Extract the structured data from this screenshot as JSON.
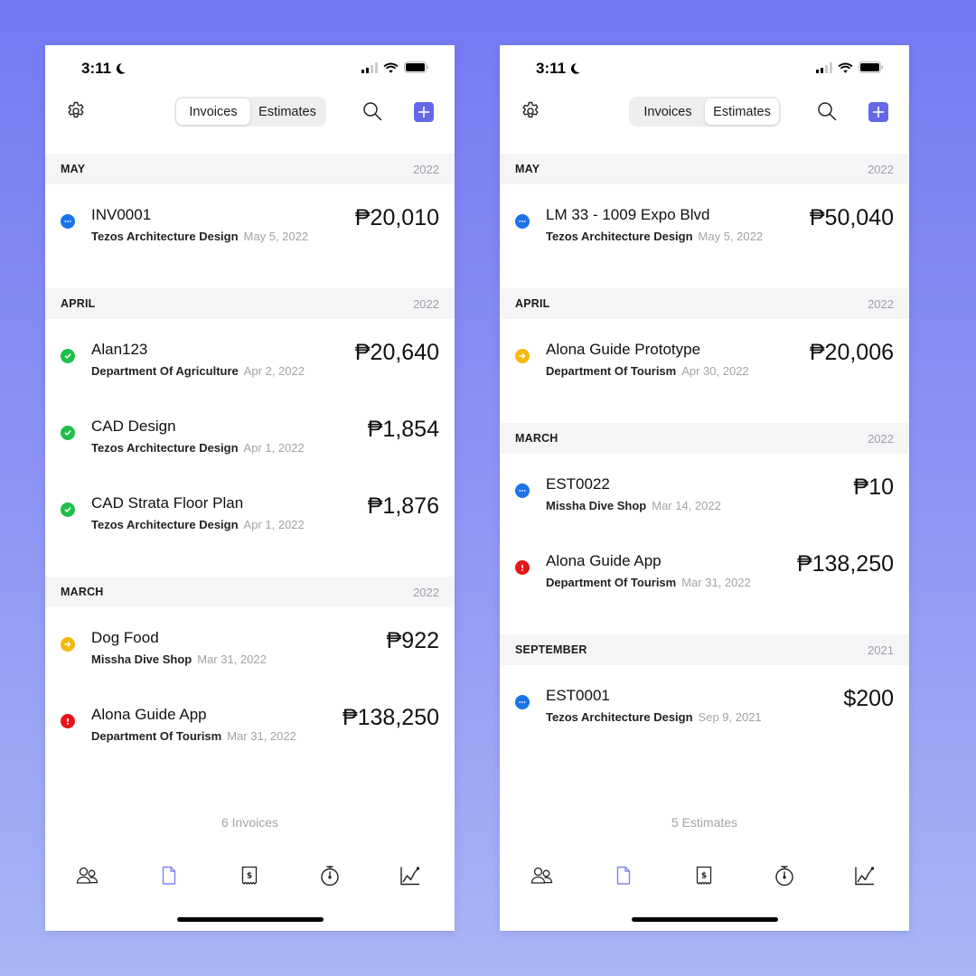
{
  "colors": {
    "accent": "#6368e8",
    "status_sent": "#1a73e8",
    "status_paid": "#1fbf4c",
    "status_partial": "#f6b80a",
    "status_overdue": "#e8141c",
    "bg_top": "#7479f3",
    "bg_bottom": "#aab5f6"
  },
  "screens": [
    {
      "status_bar": {
        "time": "3:11",
        "focus_icon": "moon-icon"
      },
      "nav": {
        "settings_icon": "gear-icon",
        "segments": [
          {
            "label": "Invoices",
            "active": true
          },
          {
            "label": "Estimates",
            "active": false
          }
        ],
        "search_icon": "search-icon",
        "add_icon": "plus-icon"
      },
      "sections": [
        {
          "month": "MAY",
          "year": "2022",
          "items": [
            {
              "title": "INV0001",
              "client": "Tezos Architecture Design",
              "date": "May 5, 2022",
              "amount": "₱20,010",
              "status": "sent"
            }
          ]
        },
        {
          "month": "APRIL",
          "year": "2022",
          "items": [
            {
              "title": "Alan123",
              "client": "Department Of Agriculture",
              "date": "Apr 2, 2022",
              "amount": "₱20,640",
              "status": "paid"
            },
            {
              "title": "CAD Design",
              "client": "Tezos Architecture Design",
              "date": "Apr 1, 2022",
              "amount": "₱1,854",
              "status": "paid"
            },
            {
              "title": "CAD Strata Floor Plan",
              "client": "Tezos Architecture Design",
              "date": "Apr 1, 2022",
              "amount": "₱1,876",
              "status": "paid"
            }
          ]
        },
        {
          "month": "MARCH",
          "year": "2022",
          "items": [
            {
              "title": "Dog Food",
              "client": "Missha Dive Shop",
              "date": "Mar 31, 2022",
              "amount": "₱922",
              "status": "partial"
            },
            {
              "title": "Alona Guide App",
              "client": "Department Of Tourism",
              "date": "Mar 31, 2022",
              "amount": "₱138,250",
              "status": "overdue"
            }
          ]
        }
      ],
      "count_label": "6 Invoices",
      "tabs": [
        {
          "icon": "clients-icon",
          "active": false
        },
        {
          "icon": "document-icon",
          "active": true
        },
        {
          "icon": "receipt-icon",
          "active": false
        },
        {
          "icon": "timer-icon",
          "active": false
        },
        {
          "icon": "chart-icon",
          "active": false
        }
      ]
    },
    {
      "status_bar": {
        "time": "3:11",
        "focus_icon": "moon-icon"
      },
      "nav": {
        "settings_icon": "gear-icon",
        "segments": [
          {
            "label": "Invoices",
            "active": false
          },
          {
            "label": "Estimates",
            "active": true
          }
        ],
        "search_icon": "search-icon",
        "add_icon": "plus-icon"
      },
      "sections": [
        {
          "month": "MAY",
          "year": "2022",
          "items": [
            {
              "title": "LM 33 - 1009 Expo Blvd",
              "client": "Tezos Architecture Design",
              "date": "May 5, 2022",
              "amount": "₱50,040",
              "status": "sent"
            }
          ]
        },
        {
          "month": "APRIL",
          "year": "2022",
          "items": [
            {
              "title": "Alona Guide Prototype",
              "client": "Department Of Tourism",
              "date": "Apr 30, 2022",
              "amount": "₱20,006",
              "status": "partial"
            }
          ]
        },
        {
          "month": "MARCH",
          "year": "2022",
          "items": [
            {
              "title": "EST0022",
              "client": "Missha Dive Shop",
              "date": "Mar 14, 2022",
              "amount": "₱10",
              "status": "sent"
            },
            {
              "title": "Alona Guide App",
              "client": "Department Of Tourism",
              "date": "Mar 31, 2022",
              "amount": "₱138,250",
              "status": "overdue"
            }
          ]
        },
        {
          "month": "SEPTEMBER",
          "year": "2021",
          "items": [
            {
              "title": "EST0001",
              "client": "Tezos Architecture Design",
              "date": "Sep 9, 2021",
              "amount": "$200",
              "status": "sent"
            }
          ]
        }
      ],
      "count_label": "5 Estimates",
      "tabs": [
        {
          "icon": "clients-icon",
          "active": false
        },
        {
          "icon": "document-icon",
          "active": true
        },
        {
          "icon": "receipt-icon",
          "active": false
        },
        {
          "icon": "timer-icon",
          "active": false
        },
        {
          "icon": "chart-icon",
          "active": false
        }
      ]
    }
  ]
}
